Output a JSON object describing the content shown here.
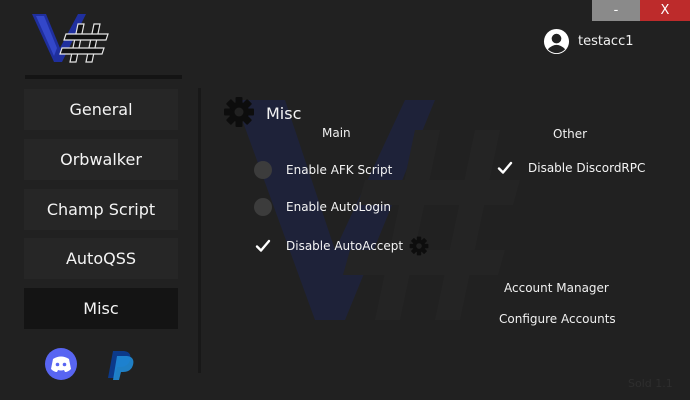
{
  "window": {
    "minimize_label": "-",
    "close_label": "X"
  },
  "user": {
    "name": "testacc1",
    "icon": "user-circle-icon"
  },
  "sidebar": {
    "items": [
      {
        "label": "General",
        "active": false
      },
      {
        "label": "Orbwalker",
        "active": false
      },
      {
        "label": "Champ Script",
        "active": false
      },
      {
        "label": "AutoQSS",
        "active": false
      },
      {
        "label": "Misc",
        "active": true
      }
    ],
    "footer_icons": [
      "discord-icon",
      "paypal-icon"
    ]
  },
  "section": {
    "title": "Misc",
    "icon": "gear-icon"
  },
  "main_column": {
    "heading": "Main",
    "options": [
      {
        "label": "Enable AFK Script",
        "checked": false
      },
      {
        "label": "Enable AutoLogin",
        "checked": false
      },
      {
        "label": "Disable AutoAccept",
        "checked": true
      }
    ]
  },
  "other_column": {
    "heading": "Other",
    "options": [
      {
        "label": "Disable DiscordRPC",
        "checked": true
      }
    ]
  },
  "actions": {
    "account_manager": "Account Manager",
    "configure_accounts": "Configure Accounts"
  },
  "footer": {
    "text": "Sold 1.1"
  },
  "colors": {
    "background": "#212121",
    "nav_button": "#262626",
    "nav_active": "#141414",
    "close_red": "#bd2b2b",
    "logo_blue": "#1f2f9e",
    "discord_blurple": "#5865f2",
    "paypal_blue": "#0c3a8a"
  }
}
